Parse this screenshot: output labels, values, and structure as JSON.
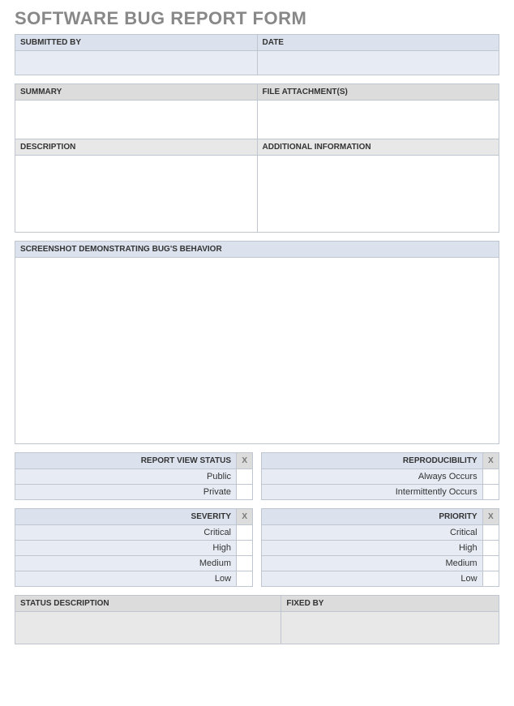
{
  "title": "SOFTWARE BUG REPORT FORM",
  "top": {
    "submitted_by_label": "SUBMITTED BY",
    "date_label": "DATE"
  },
  "summary": {
    "summary_label": "SUMMARY",
    "file_attach_label": "FILE ATTACHMENT(S)",
    "description_label": "DESCRIPTION",
    "additional_info_label": "ADDITIONAL INFORMATION"
  },
  "screenshot_label": "SCREENSHOT DEMONSTRATING BUG'S BEHAVIOR",
  "check_x": "X",
  "view_status": {
    "header": "REPORT VIEW STATUS",
    "opt1": "Public",
    "opt2": "Private"
  },
  "reproducibility": {
    "header": "REPRODUCIBILITY",
    "opt1": "Always Occurs",
    "opt2": "Intermittently Occurs"
  },
  "severity": {
    "header": "SEVERITY",
    "opt1": "Critical",
    "opt2": "High",
    "opt3": "Medium",
    "opt4": "Low"
  },
  "priority": {
    "header": "PRIORITY",
    "opt1": "Critical",
    "opt2": "High",
    "opt3": "Medium",
    "opt4": "Low"
  },
  "status": {
    "status_desc_label": "STATUS DESCRIPTION",
    "fixed_by_label": "FIXED BY"
  }
}
